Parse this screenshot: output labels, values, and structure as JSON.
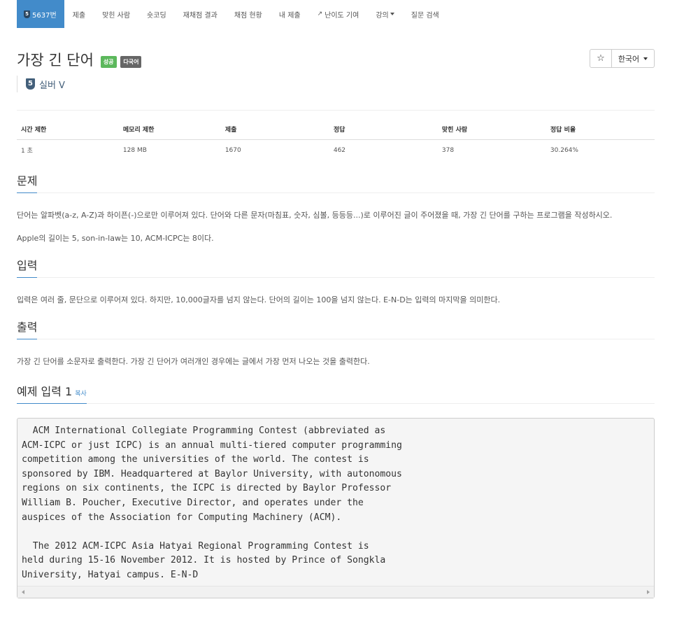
{
  "nav": {
    "problem_tier_num": "5",
    "problem_label": "5637번",
    "items": [
      "제출",
      "맞힌 사람",
      "숏코딩",
      "재채점 결과",
      "채점 현황",
      "내 제출",
      "난이도 기여",
      "강의",
      "질문 검색"
    ]
  },
  "problem": {
    "title": "가장 긴 단어",
    "badges": [
      "성공",
      "다국어"
    ],
    "tier_num": "5",
    "tier_text": "실버 V",
    "star": "☆",
    "language": "한국어"
  },
  "info": {
    "headers": [
      "시간 제한",
      "메모리 제한",
      "제출",
      "정답",
      "맞힌 사람",
      "정답 비율"
    ],
    "values": [
      "1 초",
      "128 MB",
      "1670",
      "462",
      "378",
      "30.264%"
    ]
  },
  "sections": {
    "description_title": "문제",
    "description_p1": "단어는 알파벳(a-z, A-Z)과 하이픈(-)으로만 이루어져 있다. 단어와 다른 문자(마침표, 숫자, 심볼, 등등등...)로 이루어진 글이 주어졌을 때, 가장 긴 단어를 구하는 프로그램을 작성하시오.",
    "description_p2": "Apple의 길이는 5, son-in-law는 10, ACM-ICPC는 8이다.",
    "input_title": "입력",
    "input_text": "입력은 여러 줄, 문단으로 이루어져 있다. 하지만, 10,000글자를 넘지 않는다. 단어의 길이는 100을 넘지 않는다. E-N-D는 입력의 마지막을 의미한다.",
    "output_title": "출력",
    "output_text": "가장 긴 단어를 소문자로 출력한다. 가장 긴 단어가 여러개인 경우에는 글에서 가장 먼저 나오는 것을 출력한다.",
    "sample_title": "예제 입력 1",
    "copy_label": "복사",
    "sample_input": "  ACM International Collegiate Programming Contest (abbreviated as\nACM-ICPC or just ICPC) is an annual multi-tiered computer programming\ncompetition among the universities of the world. The contest is\nsponsored by IBM. Headquartered at Baylor University, with autonomous\nregions on six continents, the ICPC is directed by Baylor Professor\nWilliam B. Poucher, Executive Director, and operates under the\nauspices of the Association for Computing Machinery (ACM).\n\n  The 2012 ACM-ICPC Asia Hatyai Regional Programming Contest is\nheld during 15-16 November 2012. It is hosted by Prince of Songkla\nUniversity, Hatyai campus. E-N-D"
  }
}
